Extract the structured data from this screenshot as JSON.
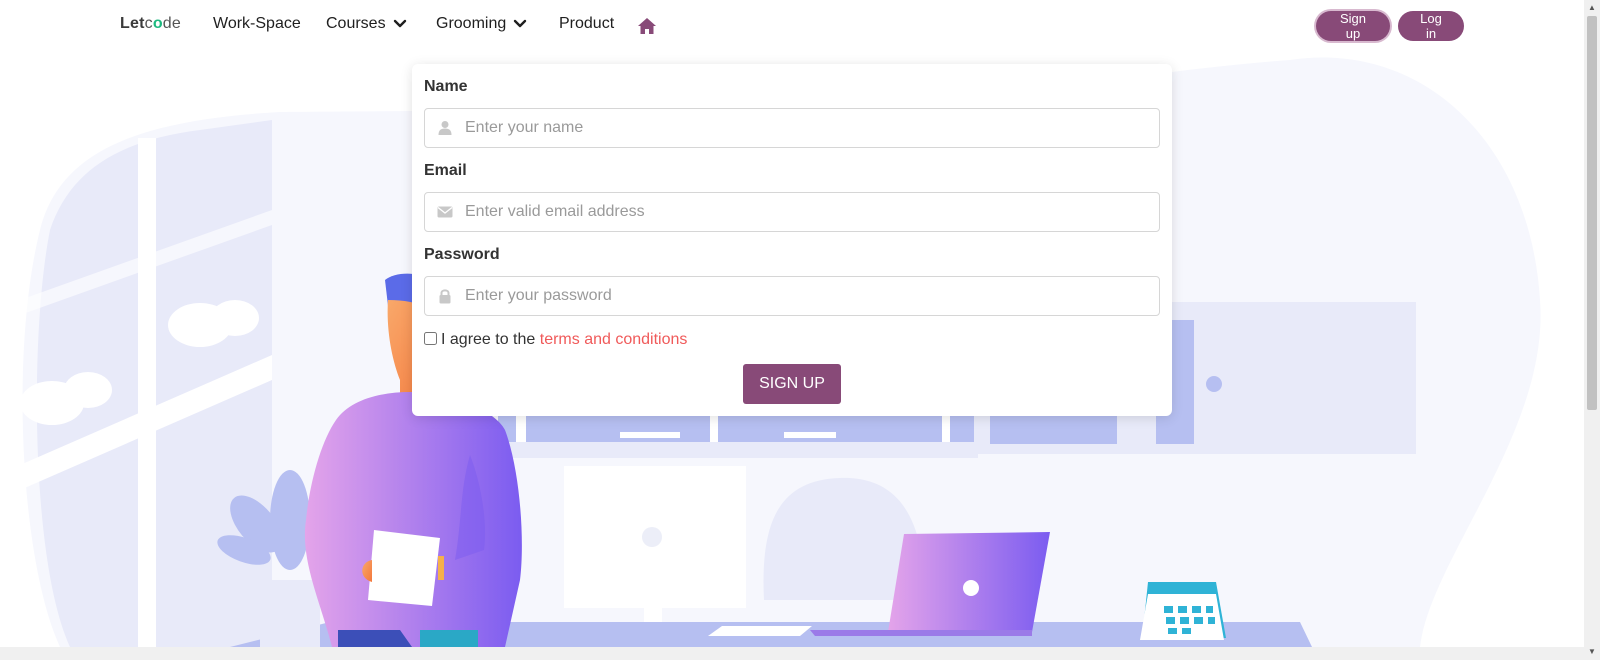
{
  "nav": {
    "brand": {
      "prefix": "Let",
      "o": "o",
      "suffix": "de",
      "c": "c"
    },
    "links": [
      {
        "label": "Work-Space"
      },
      {
        "label": "Courses",
        "dropdown": true
      },
      {
        "label": "Grooming",
        "dropdown": true
      },
      {
        "label": "Product"
      }
    ],
    "home_icon": "home-icon",
    "signup_label": "Sign up",
    "login_label": "Log in"
  },
  "form": {
    "name_label": "Name",
    "name_placeholder": "Enter your name",
    "name_icon": "user-icon",
    "email_label": "Email",
    "email_placeholder": "Enter valid email address",
    "email_icon": "envelope-icon",
    "password_label": "Password",
    "password_placeholder": "Enter your password",
    "password_icon": "lock-icon",
    "agree_prefix": "I agree to the",
    "agree_link": "terms and conditions",
    "submit_label": "SIGN UP"
  },
  "colors": {
    "accent": "#884a78",
    "link": "#f05a5a",
    "illustration_bg": "#f6f7fd",
    "illustration_blue": "#b6bff1"
  }
}
